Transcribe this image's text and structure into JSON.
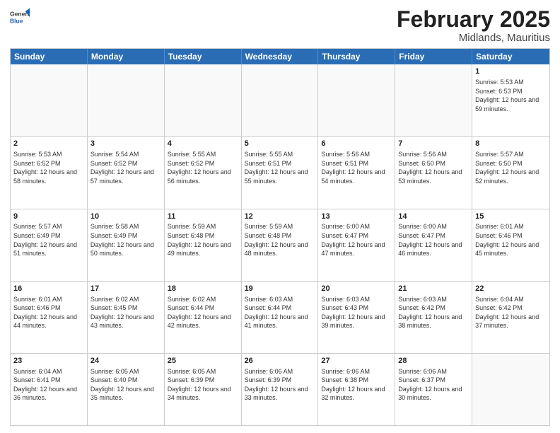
{
  "header": {
    "logo": {
      "general": "General",
      "blue": "Blue"
    },
    "month": "February 2025",
    "location": "Midlands, Mauritius"
  },
  "weekdays": [
    "Sunday",
    "Monday",
    "Tuesday",
    "Wednesday",
    "Thursday",
    "Friday",
    "Saturday"
  ],
  "rows": [
    [
      {
        "day": "",
        "sunrise": "",
        "sunset": "",
        "daylight": "",
        "empty": true
      },
      {
        "day": "",
        "sunrise": "",
        "sunset": "",
        "daylight": "",
        "empty": true
      },
      {
        "day": "",
        "sunrise": "",
        "sunset": "",
        "daylight": "",
        "empty": true
      },
      {
        "day": "",
        "sunrise": "",
        "sunset": "",
        "daylight": "",
        "empty": true
      },
      {
        "day": "",
        "sunrise": "",
        "sunset": "",
        "daylight": "",
        "empty": true
      },
      {
        "day": "",
        "sunrise": "",
        "sunset": "",
        "daylight": "",
        "empty": true
      },
      {
        "day": "1",
        "sunrise": "Sunrise: 5:53 AM",
        "sunset": "Sunset: 6:53 PM",
        "daylight": "Daylight: 12 hours and 59 minutes.",
        "empty": false
      }
    ],
    [
      {
        "day": "2",
        "sunrise": "Sunrise: 5:53 AM",
        "sunset": "Sunset: 6:52 PM",
        "daylight": "Daylight: 12 hours and 58 minutes.",
        "empty": false
      },
      {
        "day": "3",
        "sunrise": "Sunrise: 5:54 AM",
        "sunset": "Sunset: 6:52 PM",
        "daylight": "Daylight: 12 hours and 57 minutes.",
        "empty": false
      },
      {
        "day": "4",
        "sunrise": "Sunrise: 5:55 AM",
        "sunset": "Sunset: 6:52 PM",
        "daylight": "Daylight: 12 hours and 56 minutes.",
        "empty": false
      },
      {
        "day": "5",
        "sunrise": "Sunrise: 5:55 AM",
        "sunset": "Sunset: 6:51 PM",
        "daylight": "Daylight: 12 hours and 55 minutes.",
        "empty": false
      },
      {
        "day": "6",
        "sunrise": "Sunrise: 5:56 AM",
        "sunset": "Sunset: 6:51 PM",
        "daylight": "Daylight: 12 hours and 54 minutes.",
        "empty": false
      },
      {
        "day": "7",
        "sunrise": "Sunrise: 5:56 AM",
        "sunset": "Sunset: 6:50 PM",
        "daylight": "Daylight: 12 hours and 53 minutes.",
        "empty": false
      },
      {
        "day": "8",
        "sunrise": "Sunrise: 5:57 AM",
        "sunset": "Sunset: 6:50 PM",
        "daylight": "Daylight: 12 hours and 52 minutes.",
        "empty": false
      }
    ],
    [
      {
        "day": "9",
        "sunrise": "Sunrise: 5:57 AM",
        "sunset": "Sunset: 6:49 PM",
        "daylight": "Daylight: 12 hours and 51 minutes.",
        "empty": false
      },
      {
        "day": "10",
        "sunrise": "Sunrise: 5:58 AM",
        "sunset": "Sunset: 6:49 PM",
        "daylight": "Daylight: 12 hours and 50 minutes.",
        "empty": false
      },
      {
        "day": "11",
        "sunrise": "Sunrise: 5:59 AM",
        "sunset": "Sunset: 6:48 PM",
        "daylight": "Daylight: 12 hours and 49 minutes.",
        "empty": false
      },
      {
        "day": "12",
        "sunrise": "Sunrise: 5:59 AM",
        "sunset": "Sunset: 6:48 PM",
        "daylight": "Daylight: 12 hours and 48 minutes.",
        "empty": false
      },
      {
        "day": "13",
        "sunrise": "Sunrise: 6:00 AM",
        "sunset": "Sunset: 6:47 PM",
        "daylight": "Daylight: 12 hours and 47 minutes.",
        "empty": false
      },
      {
        "day": "14",
        "sunrise": "Sunrise: 6:00 AM",
        "sunset": "Sunset: 6:47 PM",
        "daylight": "Daylight: 12 hours and 46 minutes.",
        "empty": false
      },
      {
        "day": "15",
        "sunrise": "Sunrise: 6:01 AM",
        "sunset": "Sunset: 6:46 PM",
        "daylight": "Daylight: 12 hours and 45 minutes.",
        "empty": false
      }
    ],
    [
      {
        "day": "16",
        "sunrise": "Sunrise: 6:01 AM",
        "sunset": "Sunset: 6:46 PM",
        "daylight": "Daylight: 12 hours and 44 minutes.",
        "empty": false
      },
      {
        "day": "17",
        "sunrise": "Sunrise: 6:02 AM",
        "sunset": "Sunset: 6:45 PM",
        "daylight": "Daylight: 12 hours and 43 minutes.",
        "empty": false
      },
      {
        "day": "18",
        "sunrise": "Sunrise: 6:02 AM",
        "sunset": "Sunset: 6:44 PM",
        "daylight": "Daylight: 12 hours and 42 minutes.",
        "empty": false
      },
      {
        "day": "19",
        "sunrise": "Sunrise: 6:03 AM",
        "sunset": "Sunset: 6:44 PM",
        "daylight": "Daylight: 12 hours and 41 minutes.",
        "empty": false
      },
      {
        "day": "20",
        "sunrise": "Sunrise: 6:03 AM",
        "sunset": "Sunset: 6:43 PM",
        "daylight": "Daylight: 12 hours and 39 minutes.",
        "empty": false
      },
      {
        "day": "21",
        "sunrise": "Sunrise: 6:03 AM",
        "sunset": "Sunset: 6:42 PM",
        "daylight": "Daylight: 12 hours and 38 minutes.",
        "empty": false
      },
      {
        "day": "22",
        "sunrise": "Sunrise: 6:04 AM",
        "sunset": "Sunset: 6:42 PM",
        "daylight": "Daylight: 12 hours and 37 minutes.",
        "empty": false
      }
    ],
    [
      {
        "day": "23",
        "sunrise": "Sunrise: 6:04 AM",
        "sunset": "Sunset: 6:41 PM",
        "daylight": "Daylight: 12 hours and 36 minutes.",
        "empty": false
      },
      {
        "day": "24",
        "sunrise": "Sunrise: 6:05 AM",
        "sunset": "Sunset: 6:40 PM",
        "daylight": "Daylight: 12 hours and 35 minutes.",
        "empty": false
      },
      {
        "day": "25",
        "sunrise": "Sunrise: 6:05 AM",
        "sunset": "Sunset: 6:39 PM",
        "daylight": "Daylight: 12 hours and 34 minutes.",
        "empty": false
      },
      {
        "day": "26",
        "sunrise": "Sunrise: 6:06 AM",
        "sunset": "Sunset: 6:39 PM",
        "daylight": "Daylight: 12 hours and 33 minutes.",
        "empty": false
      },
      {
        "day": "27",
        "sunrise": "Sunrise: 6:06 AM",
        "sunset": "Sunset: 6:38 PM",
        "daylight": "Daylight: 12 hours and 32 minutes.",
        "empty": false
      },
      {
        "day": "28",
        "sunrise": "Sunrise: 6:06 AM",
        "sunset": "Sunset: 6:37 PM",
        "daylight": "Daylight: 12 hours and 30 minutes.",
        "empty": false
      },
      {
        "day": "",
        "sunrise": "",
        "sunset": "",
        "daylight": "",
        "empty": true
      }
    ]
  ]
}
